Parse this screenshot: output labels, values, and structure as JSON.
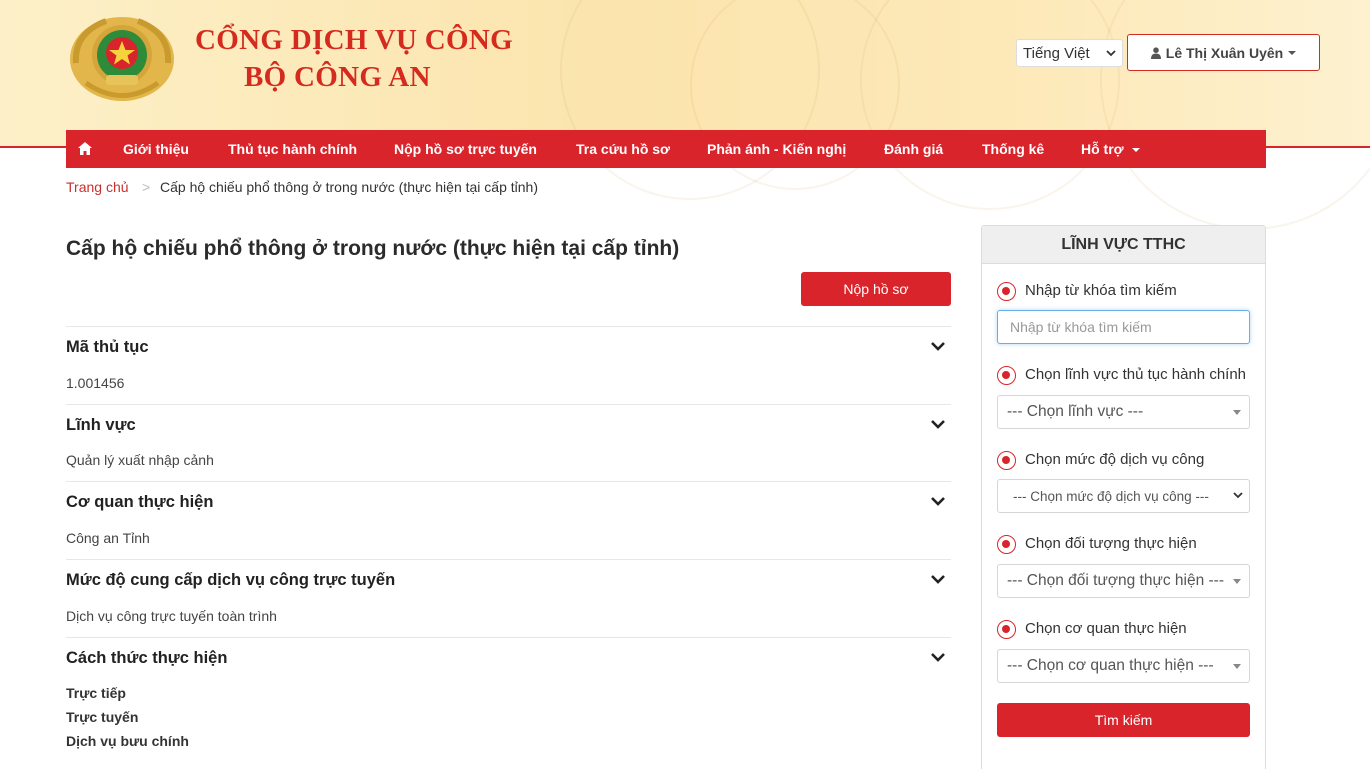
{
  "header": {
    "brand_line1": "CỔNG DỊCH VỤ CÔNG",
    "brand_line2": "BỘ CÔNG AN",
    "language": "Tiếng Việt",
    "user_name": "Lê Thị Xuân Uyên",
    "logo_icon": "police-emblem-icon",
    "colors": {
      "brand_red": "#d9242b",
      "header_bg": "#fbe4ad"
    }
  },
  "nav": {
    "home_icon": "home-icon",
    "items": [
      {
        "label": "Giới thiệu"
      },
      {
        "label": "Thủ tục hành chính"
      },
      {
        "label": "Nộp hồ sơ trực tuyến"
      },
      {
        "label": "Tra cứu hồ sơ"
      },
      {
        "label": "Phản ánh - Kiến nghị"
      },
      {
        "label": "Đánh giá"
      },
      {
        "label": "Thống kê"
      },
      {
        "label": "Hỗ trợ"
      }
    ]
  },
  "breadcrumb": {
    "home": "Trang chủ",
    "separator": ">",
    "current": "Cấp hộ chiếu phổ thông ở trong nước (thực hiện tại cấp tỉnh)"
  },
  "main": {
    "title": "Cấp hộ chiếu phổ thông ở trong nước (thực hiện tại cấp tỉnh)",
    "submit_label": "Nộp hồ sơ",
    "sections": [
      {
        "title": "Mã thủ tục",
        "values": [
          "1.001456"
        ]
      },
      {
        "title": "Lĩnh vực",
        "values": [
          "Quản lý xuất nhập cảnh"
        ]
      },
      {
        "title": "Cơ quan thực hiện",
        "values": [
          "Công an Tỉnh"
        ]
      },
      {
        "title": "Mức độ cung cấp dịch vụ công trực tuyến",
        "values": [
          "Dịch vụ công trực tuyến toàn trình"
        ]
      },
      {
        "title": "Cách thức thực hiện",
        "values": [
          "Trực tiếp",
          "Trực tuyến",
          "Dịch vụ bưu chính"
        ]
      }
    ]
  },
  "sidebar": {
    "heading": "LĨNH VỰC TTHC",
    "keyword_label": "Nhập từ khóa tìm kiếm",
    "keyword_placeholder": "Nhập từ khóa tìm kiếm",
    "field_label": "Chọn lĩnh vực thủ tục hành chính",
    "field_select": "--- Chọn lĩnh vực ---",
    "level_label": "Chọn mức độ dịch vụ công",
    "level_select": "--- Chọn mức độ dịch vụ công ---",
    "target_label": "Chọn đối tượng thực hiện",
    "target_select": "--- Chọn đối tượng thực hiện ---",
    "agency_label": "Chọn cơ quan thực hiện",
    "agency_select": "--- Chọn cơ quan thực hiện ---",
    "search_label": "Tìm kiếm"
  }
}
